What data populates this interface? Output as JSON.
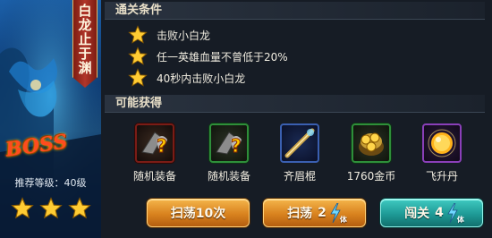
{
  "stage": {
    "title": "白龙止于渊",
    "boss_label": "BOSS",
    "recommended_level": "推荐等级：40级",
    "stars_earned": 3
  },
  "conditions": {
    "heading": "通关条件",
    "items": [
      {
        "text": "击败小白龙"
      },
      {
        "text": "任一英雄血量不曾低于20%"
      },
      {
        "text": "40秒内击败小白龙"
      }
    ]
  },
  "rewards": {
    "heading": "可能获得",
    "items": [
      {
        "name": "随机装备",
        "icon": "mystery-equipment-red-icon",
        "frame": "red"
      },
      {
        "name": "随机装备",
        "icon": "mystery-equipment-green-icon",
        "frame": "green"
      },
      {
        "name": "齐眉棍",
        "icon": "staff-icon",
        "frame": "blue"
      },
      {
        "name": "1760金币",
        "icon": "gold-coins-icon",
        "frame": "green"
      },
      {
        "name": "飞升丹",
        "icon": "ascension-pill-icon",
        "frame": "purple"
      }
    ]
  },
  "buttons": {
    "sweep_ten": "扫荡10次",
    "sweep": "扫荡",
    "sweep_cost": "2",
    "challenge": "闯关",
    "challenge_cost": "4",
    "stamina_unit": "体"
  },
  "colors": {
    "star_gold": "#ffcc33",
    "button_orange": "#d8821e",
    "button_teal": "#1e9a96"
  }
}
